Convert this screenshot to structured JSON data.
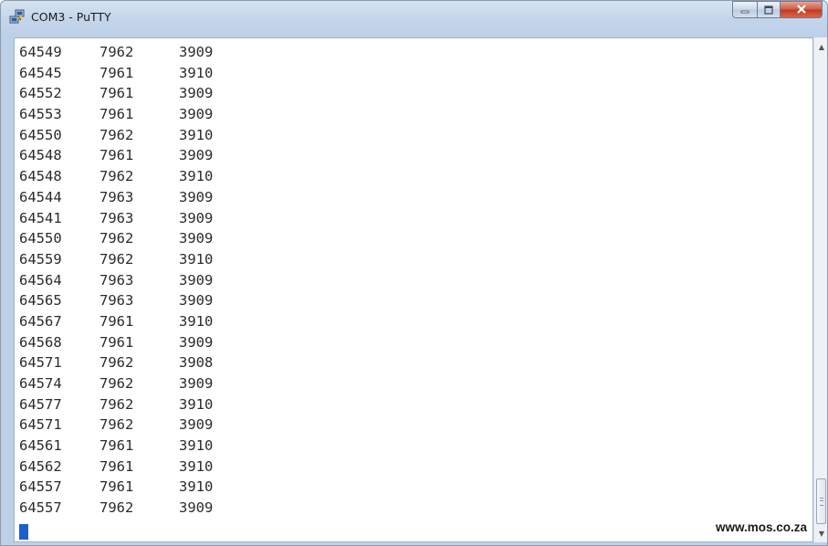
{
  "window": {
    "title": "COM3 - PuTTY",
    "app_icon": "putty-icon",
    "controls": [
      "minimize-icon",
      "maximize-icon",
      "close-icon"
    ],
    "close_color": "#c4371f"
  },
  "terminal": {
    "rows": [
      [
        "64549",
        "7962",
        "3909"
      ],
      [
        "64545",
        "7961",
        "3910"
      ],
      [
        "64552",
        "7961",
        "3909"
      ],
      [
        "64553",
        "7961",
        "3909"
      ],
      [
        "64550",
        "7962",
        "3910"
      ],
      [
        "64548",
        "7961",
        "3909"
      ],
      [
        "64548",
        "7962",
        "3910"
      ],
      [
        "64544",
        "7963",
        "3909"
      ],
      [
        "64541",
        "7963",
        "3909"
      ],
      [
        "64550",
        "7962",
        "3909"
      ],
      [
        "64559",
        "7962",
        "3910"
      ],
      [
        "64564",
        "7963",
        "3909"
      ],
      [
        "64565",
        "7963",
        "3909"
      ],
      [
        "64567",
        "7961",
        "3910"
      ],
      [
        "64568",
        "7961",
        "3909"
      ],
      [
        "64571",
        "7962",
        "3908"
      ],
      [
        "64574",
        "7962",
        "3909"
      ],
      [
        "64577",
        "7962",
        "3910"
      ],
      [
        "64571",
        "7962",
        "3909"
      ],
      [
        "64561",
        "7961",
        "3910"
      ],
      [
        "64562",
        "7961",
        "3910"
      ],
      [
        "64557",
        "7961",
        "3910"
      ],
      [
        "64557",
        "7962",
        "3909"
      ]
    ],
    "cursor_color": "#1e5fd0"
  },
  "watermark": "www.mos.co.za",
  "scrollbar": {
    "up_icon": "scroll-up-arrow-icon",
    "down_icon": "scroll-down-arrow-icon",
    "position": 0.97
  }
}
